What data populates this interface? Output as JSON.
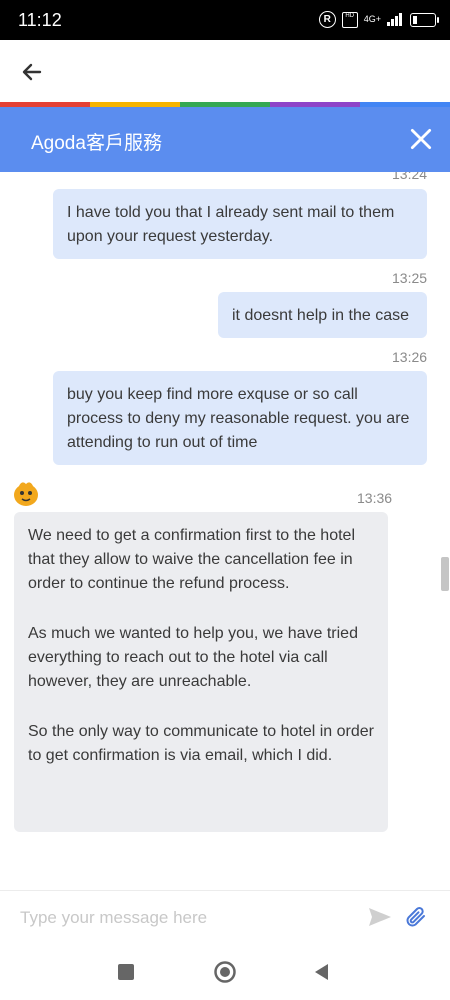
{
  "status_bar": {
    "time": "11:12",
    "network": "4G+",
    "reg_symbol": "R",
    "hd_symbol": "HD"
  },
  "strip_colors": [
    "#e44134",
    "#f6b400",
    "#35a853",
    "#8e44c8",
    "#4285f4"
  ],
  "header": {
    "title": "Agoda客戶服務",
    "background": "#5b8def"
  },
  "messages": [
    {
      "sender": "user",
      "time": "13:24",
      "text": "I have told you that I already sent mail to them upon your request yesterday."
    },
    {
      "sender": "user",
      "time": "13:25",
      "text": "it doesnt help in the case"
    },
    {
      "sender": "user",
      "time": "13:26",
      "text": "buy you keep find more exquse or so call process to deny my reasonable request. you are attending to run out of time"
    },
    {
      "sender": "agent",
      "time": "13:36",
      "paragraphs": [
        "We need to get a confirmation first to the hotel that they allow to waive the cancellation fee in order to continue the refund process.",
        "As much we wanted to help you, we have tried everything to reach out to the hotel via call however, they are unreachable.",
        "So the only way to communicate to hotel in order to get confirmation is via email, which I did."
      ]
    }
  ],
  "composer": {
    "placeholder": "Type your message here",
    "value": ""
  },
  "icons": [
    "back-arrow-icon",
    "close-icon",
    "agent-avatar-icon",
    "send-icon",
    "attach-icon",
    "recent-apps-icon",
    "home-icon",
    "back-icon"
  ]
}
